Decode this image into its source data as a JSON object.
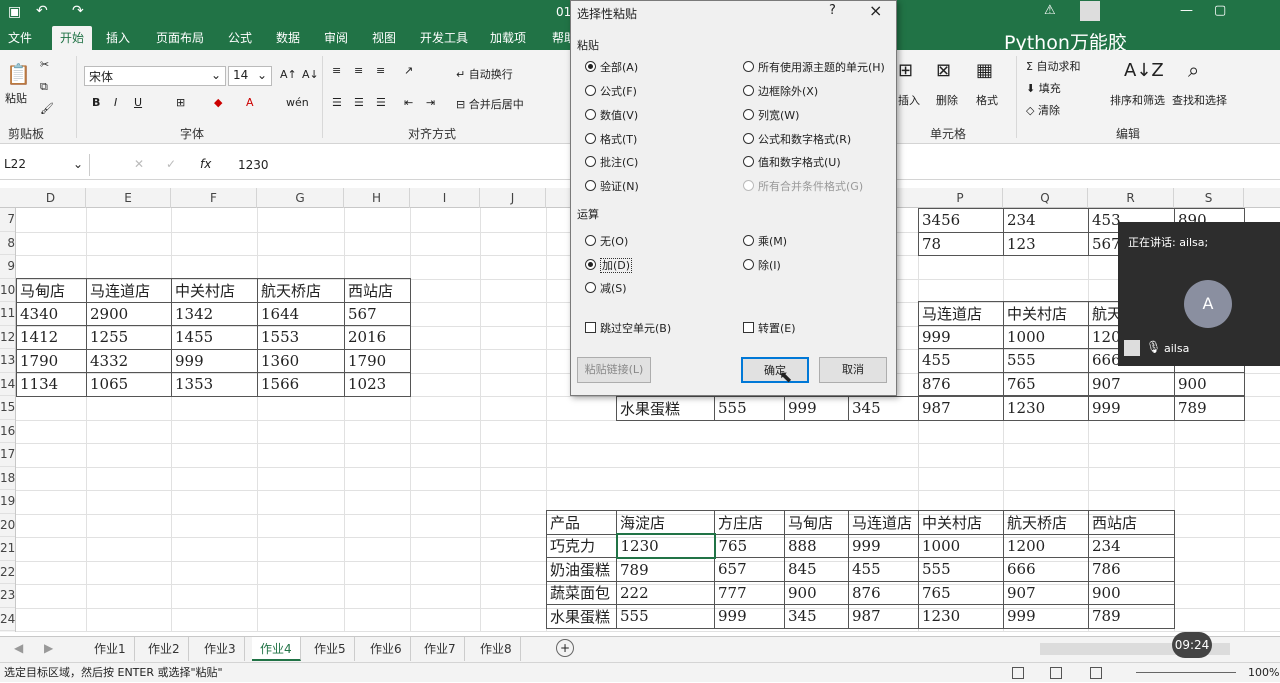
{
  "titlebar": {
    "doc": "01",
    "caption": "选择性粘贴"
  },
  "tabs": [
    "文件",
    "开始",
    "插入",
    "页面布局",
    "公式",
    "数据",
    "审阅",
    "视图",
    "开发工具",
    "加载项",
    "帮助"
  ],
  "watermark": "Python万能胶",
  "ribbon": {
    "paste": "粘贴",
    "clipboard": "剪贴板",
    "font_name": "宋体",
    "font_size": "14",
    "font_group": "字体",
    "bold": "B",
    "italic": "I",
    "underline": "U",
    "wrap": "自动换行",
    "merge": "合并后居中",
    "align_group": "对齐方式",
    "insert": "插入",
    "delete": "删除",
    "format": "格式",
    "cells_group": "单元格",
    "autosum": "自动求和",
    "fill": "填充",
    "clear": "清除",
    "sort": "排序和筛选",
    "find": "查找和选择",
    "edit_group": "编辑"
  },
  "formula": {
    "namebox": "L22",
    "fx": "fx",
    "value": "1230"
  },
  "col_headers": [
    "D",
    "E",
    "F",
    "G",
    "H",
    "I",
    "J",
    "P",
    "Q",
    "R",
    "S"
  ],
  "row_headers": [
    "7",
    "8",
    "9",
    "10",
    "11",
    "12",
    "13",
    "14",
    "15",
    "16",
    "17",
    "18",
    "19",
    "20",
    "21",
    "22",
    "23",
    "24",
    "25"
  ],
  "left_table": {
    "header": [
      "马甸店",
      "马连道店",
      "中关村店",
      "航天桥店",
      "西站店"
    ],
    "rows": [
      [
        "4340",
        "2900",
        "1342",
        "1644",
        "567"
      ],
      [
        "1412",
        "1255",
        "1455",
        "1553",
        "2016"
      ],
      [
        "1790",
        "4332",
        "999",
        "1360",
        "1790"
      ],
      [
        "1134",
        "1065",
        "1353",
        "1566",
        "1023"
      ]
    ]
  },
  "top_right": {
    "rows": [
      [
        "3456",
        "234",
        "453",
        "890"
      ],
      [
        "78",
        "123",
        "567",
        ""
      ]
    ]
  },
  "mid_right": {
    "header": [
      "马连道店",
      "中关村店",
      "航天"
    ],
    "rows": [
      [
        "999",
        "1000",
        "120"
      ],
      [
        "455",
        "555",
        "666"
      ],
      [
        "876",
        "765",
        "907",
        "900"
      ]
    ],
    "last": [
      "水果蛋糕",
      "555",
      "999",
      "345",
      "987",
      "1230",
      "999",
      "789"
    ]
  },
  "bottom_table": {
    "header": [
      "产品",
      "海淀店",
      "方庄店",
      "马甸店",
      "马连道店",
      "中关村店",
      "航天桥店",
      "西站店"
    ],
    "rows": [
      [
        "巧克力",
        "1230",
        "765",
        "888",
        "999",
        "1000",
        "1200",
        "234"
      ],
      [
        "奶油蛋糕",
        "789",
        "657",
        "845",
        "455",
        "555",
        "666",
        "786"
      ],
      [
        "蔬菜面包",
        "222",
        "777",
        "900",
        "876",
        "765",
        "907",
        "900"
      ],
      [
        "水果蛋糕",
        "555",
        "999",
        "345",
        "987",
        "1230",
        "999",
        "789"
      ]
    ]
  },
  "dialog": {
    "title": "选择性粘贴",
    "help": "?",
    "close": "×",
    "paste_label": "粘贴",
    "paste_opts": [
      "全部(A)",
      "公式(F)",
      "数值(V)",
      "格式(T)",
      "批注(C)",
      "验证(N)"
    ],
    "paste_opts_right": [
      "所有使用源主题的单元(H)",
      "边框除外(X)",
      "列宽(W)",
      "公式和数字格式(R)",
      "值和数字格式(U)",
      "所有合并条件格式(G)"
    ],
    "op_label": "运算",
    "op_left": [
      "无(O)",
      "加(D)",
      "减(S)"
    ],
    "op_right": [
      "乘(M)",
      "除(I)"
    ],
    "skip_blanks": "跳过空单元(B)",
    "transpose": "转置(E)",
    "paste_link": "粘贴链接(L)",
    "ok": "确定",
    "cancel": "取消"
  },
  "meeting": {
    "speaking": "正在讲话: ailsa;",
    "avatar": "A",
    "name": "ailsa"
  },
  "sheets": [
    "作业1",
    "作业2",
    "作业3",
    "作业4",
    "作业5",
    "作业6",
    "作业7",
    "作业8"
  ],
  "status": {
    "text": "选定目标区域，然后按 ENTER 或选择\"粘贴\"",
    "time": "09:24",
    "zoom": "100%"
  }
}
